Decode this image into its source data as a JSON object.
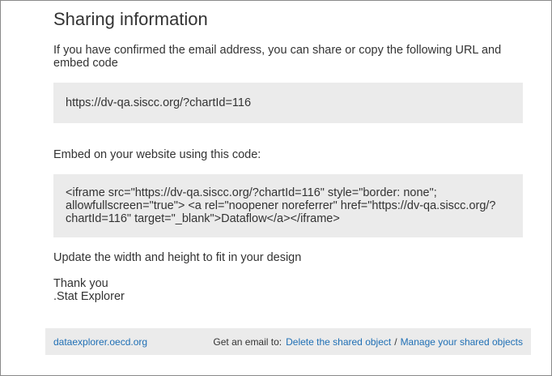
{
  "dialog": {
    "title": "Sharing information",
    "intro": "If you have confirmed the email address, you can share or copy the following URL and embed code",
    "url": "https://dv-qa.siscc.org/?chartId=116",
    "embed_label": "Embed on your website using this code:",
    "embed_code": "<iframe src=\"https://dv-qa.siscc.org/?chartId=116\" style=\"border: none\"; allowfullscreen=\"true\"> <a rel=\"noopener noreferrer\" href=\"https://dv-qa.siscc.org/?chartId=116\" target=\"_blank\">Dataflow</a></iframe>",
    "update_text": "Update the width and height to fit in your design",
    "thanks": "Thank you",
    "signature": ".Stat Explorer"
  },
  "footer": {
    "site_link": "dataexplorer.oecd.org",
    "email_prefix": "Get an email to:",
    "delete_link": "Delete the shared object",
    "separator": "/",
    "manage_link": "Manage your shared objects"
  },
  "colors": {
    "link": "#1f6fb5",
    "box_background": "#ebebeb",
    "text": "#333333"
  }
}
